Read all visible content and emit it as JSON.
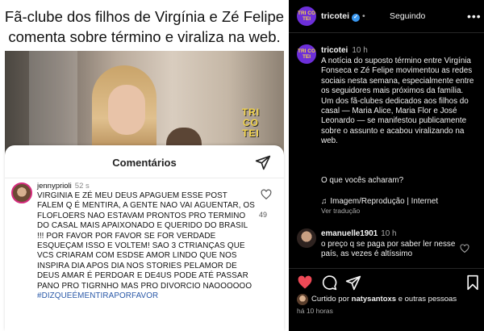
{
  "post_image": {
    "headline": "Fã-clube dos filhos de Virgínia e Zé Felipe comenta sobre término e viraliza na web.",
    "badge_text": "TRI CO TEI",
    "comments_sheet": {
      "title": "Comentários",
      "send_icon": "paper-plane-icon",
      "comment": {
        "username": "jennyprioli",
        "time": "52 s",
        "body": "VIRGINIA E ZÉ MEU DEUS APAGUEM ESSE POST FALEM Q É MENTIRA, A GENTE NAO VAI AGUENTAR, OS FLOFLOERS NAO ESTAVAM PRONTOS PRO TERMINO DO CASAL MAIS APAIXONADO E QUERIDO DO BRASIL !!! POR FAVOR POR FAVOR SE FOR VERDADE ESQUEÇAM ISSO E VOLTEM! SAO 3 CTRIANÇAS QUE VCS CRIARAM COM ESDSE AMOR LINDO QUE NOS INSPIRA DIA APOS DIA NOS STORIES PELAMOR DE DEUS AMAR É PERDOAR E DE4US PODE ATÉ PASSAR PANO PRO TIGRNHO MAS PRO DIVORCIO NAOOOOOO",
        "hashtag": "#DIZQUEÉMENTIRAPORFAVOR",
        "likes": "49",
        "heart_icon": "heart-outline-icon"
      }
    }
  },
  "instagram": {
    "header": {
      "avatar_text": "TRI CO TEI",
      "username": "tricotei",
      "verified_icon": "verified-badge-icon",
      "separator": "•",
      "follow_status": "Seguindo",
      "more_icon": "•••"
    },
    "caption": {
      "username": "tricotei",
      "time": "10 h",
      "text": "A notícia do suposto término entre Virgínia Fonseca e Zé Felipe movimentou as redes sociais nesta semana, especialmente entre os seguidores mais próximos da família. Um dos fã-clubes dedicados aos filhos do casal — Maria Alice, Maria Flor e José Leonardo — se manifestou publicamente sobre o assunto e acabou viralizando na web.",
      "question": "O que vocês acharam?",
      "audio_label": "Imagem/Reprodução | Internet",
      "audio_icon": "♫",
      "see_translation": "Ver tradução"
    },
    "reply": {
      "username": "emanuelle1901",
      "time": "10 h",
      "text": "o preço q se paga por saber ler nesse país, as vezes é altíssimo"
    },
    "actions": {
      "like_icon": "heart-filled-icon",
      "comment_icon": "comment-bubble-icon",
      "share_icon": "paper-plane-icon",
      "save_icon": "bookmark-icon",
      "liked_prefix": "Curtido por ",
      "liked_user": "natysantoxs",
      "liked_suffix": " e outras pessoas",
      "post_age": "há 10 horas"
    },
    "colors": {
      "background": "#000000",
      "like_red": "#ed4956",
      "verified_blue": "#3897f0",
      "avatar_purple": "#6d2fd9",
      "hashtag_blue": "#2a59a8"
    }
  }
}
